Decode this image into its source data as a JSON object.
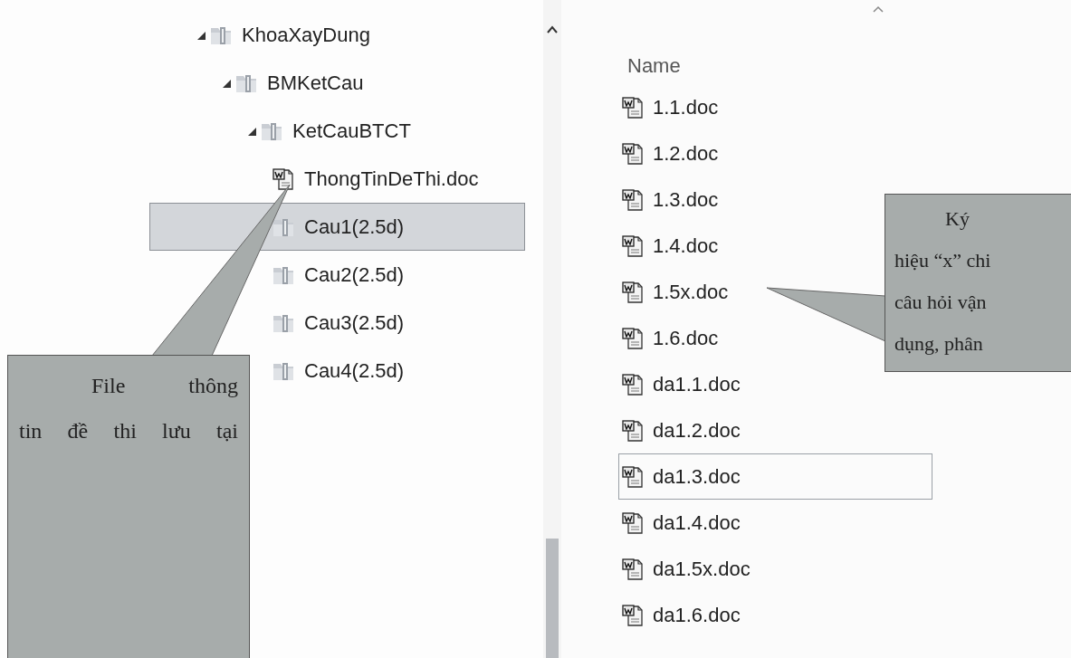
{
  "tree": [
    {
      "label": "KhoaXayDung",
      "kind": "folder",
      "expanded": true,
      "selected": false,
      "children": [
        {
          "label": "BMKetCau",
          "kind": "folder",
          "expanded": true,
          "selected": false,
          "children": [
            {
              "label": "KetCauBTCT",
              "kind": "folder",
              "expanded": true,
              "selected": false,
              "children": [
                {
                  "label": "ThongTinDeThi.doc",
                  "kind": "document",
                  "selected": false
                },
                {
                  "label": "Cau1(2.5d)",
                  "kind": "folder",
                  "selected": true
                },
                {
                  "label": "Cau2(2.5d)",
                  "kind": "folder",
                  "selected": false
                },
                {
                  "label": "Cau3(2.5d)",
                  "kind": "folder",
                  "selected": false
                },
                {
                  "label": "Cau4(2.5d)",
                  "kind": "folder",
                  "selected": false
                }
              ]
            }
          ]
        }
      ]
    }
  ],
  "list": {
    "column": "Name",
    "rows": [
      {
        "label": "1.1.doc",
        "focused": false
      },
      {
        "label": "1.2.doc",
        "focused": false
      },
      {
        "label": "1.3.doc",
        "focused": false
      },
      {
        "label": "1.4.doc",
        "focused": false
      },
      {
        "label": "1.5x.doc",
        "focused": false
      },
      {
        "label": "1.6.doc",
        "focused": false
      },
      {
        "label": "da1.1.doc",
        "focused": false
      },
      {
        "label": "da1.2.doc",
        "focused": false
      },
      {
        "label": "da1.3.doc",
        "focused": true
      },
      {
        "label": "da1.4.doc",
        "focused": false
      },
      {
        "label": "da1.5x.doc",
        "focused": false
      },
      {
        "label": "da1.6.doc",
        "focused": false
      }
    ]
  },
  "callouts": [
    {
      "lines": [
        "File thông",
        "tin đề thi lưu tại"
      ]
    },
    {
      "lines": [
        "Ký",
        "hiệu “x” chi",
        "câu hỏi vận",
        "dụng, phân"
      ]
    }
  ]
}
